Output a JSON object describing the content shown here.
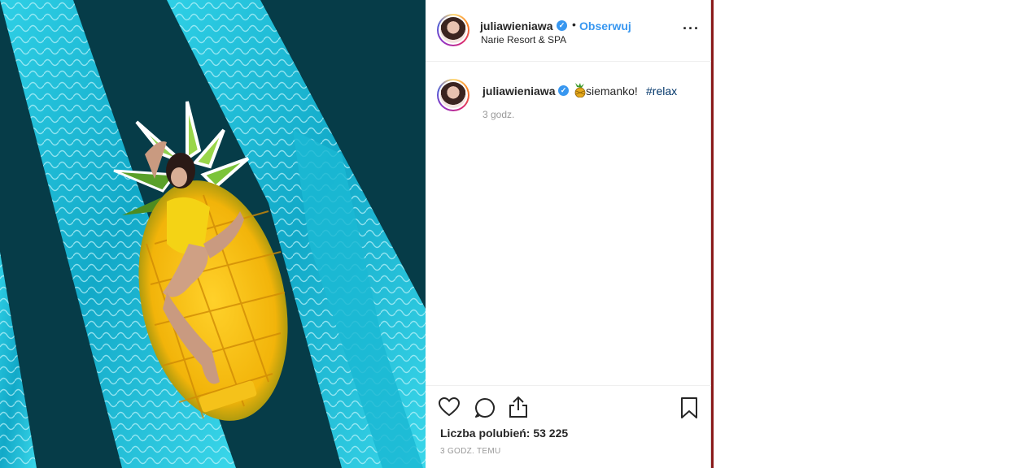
{
  "post": {
    "image_alt": "woman on pineapple float in pool",
    "header": {
      "username": "juliawieniawa",
      "separator": "•",
      "follow_label": "Obserwuj",
      "location": "Narie Resort & SPA",
      "more_icon": "more-horizontal-icon"
    },
    "caption": {
      "username": "juliawieniawa",
      "emoji": "pineapple-emoji",
      "text": "siemanko!",
      "hashtag": "#relax",
      "time": "3 godz."
    },
    "actions": {
      "like_icon": "heart-icon",
      "comment_icon": "comment-icon",
      "share_icon": "share-icon",
      "save_icon": "bookmark-icon"
    },
    "likes_text": "Liczba polubień: 53 225",
    "posted_ago": "3 GODZ. TEMU"
  },
  "colors": {
    "link": "#3897f0",
    "hashtag": "#003569",
    "text": "#262626",
    "muted": "#999999",
    "pool_dark": "#063c48",
    "pool_light": "#1fc3dc"
  }
}
